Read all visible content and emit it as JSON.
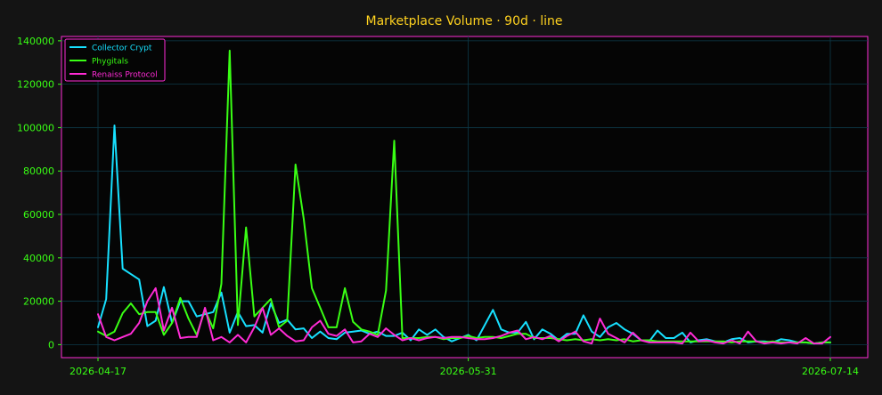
{
  "chart_data": {
    "type": "line",
    "title": "Marketplace Volume · 90d · line",
    "xlabel": "",
    "ylabel": "",
    "x_start": "2026-04-17",
    "x_end": "2026-07-14",
    "xticks": [
      "2026-04-17",
      "2026-05-31",
      "2026-07-14"
    ],
    "yticks": [
      0,
      20000,
      40000,
      60000,
      80000,
      100000,
      120000,
      140000
    ],
    "ylim": [
      -6000,
      142000
    ],
    "grid": true,
    "legend_position": "top-left",
    "series": [
      {
        "name": "Collector Crypt",
        "color": "#17e0ff",
        "values": [
          8000,
          21000,
          101000,
          35000,
          32500,
          30000,
          8500,
          11000,
          26500,
          10000,
          20000,
          20000,
          13000,
          14000,
          15000,
          24000,
          5500,
          15000,
          8500,
          9000,
          5500,
          19000,
          10000,
          11500,
          7000,
          7500,
          3000,
          6000,
          3000,
          2500,
          5500,
          6000,
          6500,
          5000,
          6000,
          4000,
          4000,
          5500,
          2000,
          7000,
          4500,
          7000,
          3500,
          1500,
          3000,
          4500,
          2000,
          9000,
          16000,
          7000,
          5500,
          5500,
          10500,
          2500,
          7000,
          5000,
          2000,
          5000,
          5000,
          13500,
          6000,
          3500,
          8000,
          10000,
          7000,
          5000,
          2000,
          1500,
          6500,
          3000,
          3000,
          5500,
          1000,
          2000,
          2500,
          1500,
          1000,
          2500,
          3000,
          1000,
          1500,
          1500,
          1000,
          2500,
          2000,
          1000,
          1000,
          500,
          1000,
          1000
        ]
      },
      {
        "name": "Phygitals",
        "color": "#39ff14",
        "values": [
          6000,
          4000,
          6000,
          14500,
          19000,
          14000,
          15000,
          15000,
          4500,
          10000,
          21500,
          12000,
          4500,
          16000,
          7500,
          28000,
          135500,
          9000,
          54000,
          13000,
          17000,
          21000,
          8000,
          11000,
          83000,
          58000,
          26000,
          17000,
          8000,
          8000,
          26000,
          10500,
          7000,
          6000,
          4500,
          25000,
          94000,
          3000,
          3000,
          3000,
          3500,
          3500,
          2500,
          3000,
          3000,
          4000,
          3000,
          3500,
          3500,
          3000,
          4000,
          5000,
          5000,
          3000,
          3000,
          3000,
          2500,
          2000,
          2500,
          2000,
          2500,
          2000,
          2500,
          2000,
          2500,
          1500,
          2000,
          2000,
          1500,
          1500,
          1500,
          1500,
          1500,
          1500,
          1500,
          1500,
          1500,
          1000,
          1500,
          1500,
          1500,
          1000,
          1500,
          1000,
          1000,
          1000,
          1000,
          500,
          1000,
          1000
        ]
      },
      {
        "name": "Renaiss Protocol",
        "color": "#ff2bd6",
        "values": [
          14000,
          3500,
          2000,
          3500,
          5000,
          10000,
          20000,
          26000,
          6500,
          17000,
          3000,
          3500,
          3500,
          17000,
          2000,
          3500,
          1000,
          4500,
          1000,
          8000,
          17000,
          4500,
          7500,
          4000,
          1500,
          2000,
          8000,
          11000,
          5000,
          4000,
          7000,
          1000,
          1500,
          5000,
          3500,
          7500,
          4500,
          2000,
          3000,
          2000,
          3000,
          3500,
          3000,
          3500,
          3500,
          3000,
          2500,
          2500,
          3000,
          4000,
          5500,
          6500,
          2500,
          3500,
          2500,
          4000,
          1500,
          4000,
          6000,
          1500,
          500,
          12000,
          5000,
          3000,
          1000,
          5500,
          2000,
          1000,
          1000,
          1000,
          1000,
          500,
          5500,
          1500,
          2000,
          1000,
          500,
          2000,
          500,
          6000,
          1500,
          500,
          1000,
          500,
          1000,
          500,
          3000,
          500,
          500,
          3500
        ]
      }
    ]
  }
}
